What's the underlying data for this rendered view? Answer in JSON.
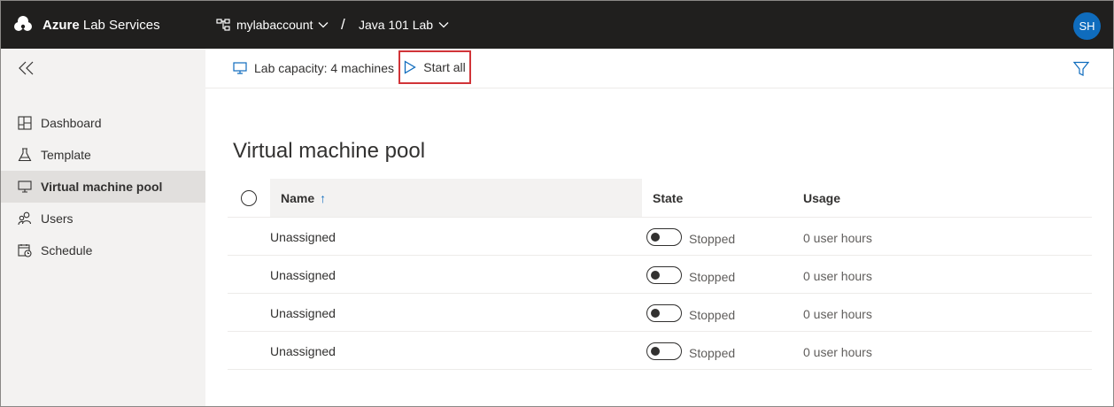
{
  "header": {
    "brand_bold": "Azure",
    "brand_rest": " Lab Services",
    "account": "mylabaccount",
    "separator": "/",
    "lab": "Java 101 Lab",
    "avatar_initials": "SH",
    "accent": "#0f6cbd"
  },
  "sidebar": {
    "collapse_icon": "double-chevron-left-icon",
    "items": [
      {
        "label": "Dashboard",
        "icon": "dashboard-icon",
        "active": false
      },
      {
        "label": "Template",
        "icon": "flask-icon",
        "active": false
      },
      {
        "label": "Virtual machine pool",
        "icon": "monitor-icon",
        "active": true
      },
      {
        "label": "Users",
        "icon": "users-icon",
        "active": false
      },
      {
        "label": "Schedule",
        "icon": "calendar-icon",
        "active": false
      }
    ]
  },
  "toolbar": {
    "capacity_label": "Lab capacity: 4 machines",
    "start_all_label": "Start all"
  },
  "main": {
    "title": "Virtual machine pool",
    "columns": {
      "name": "Name",
      "name_sort": "↑",
      "state": "State",
      "usage": "Usage"
    },
    "rows": [
      {
        "name": "Unassigned",
        "state": "Stopped",
        "usage": "0 user hours"
      },
      {
        "name": "Unassigned",
        "state": "Stopped",
        "usage": "0 user hours"
      },
      {
        "name": "Unassigned",
        "state": "Stopped",
        "usage": "0 user hours"
      },
      {
        "name": "Unassigned",
        "state": "Stopped",
        "usage": "0 user hours"
      }
    ]
  }
}
